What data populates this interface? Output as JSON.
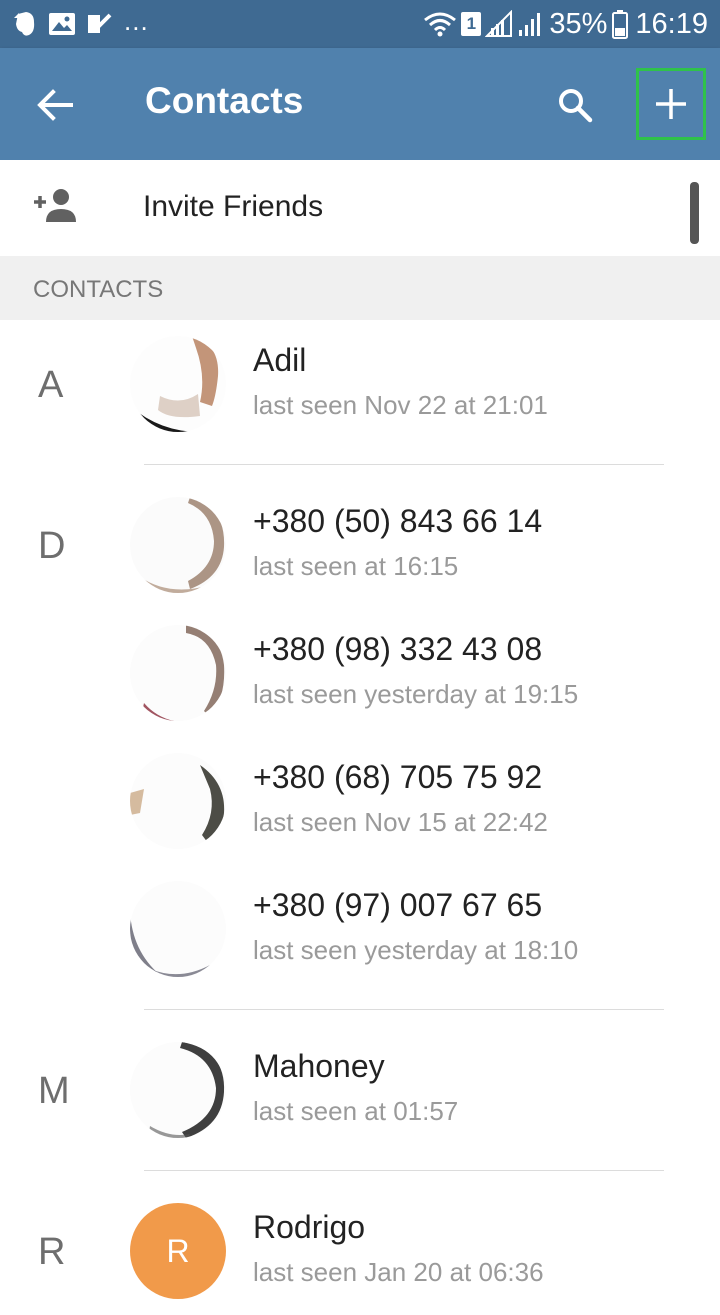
{
  "status_bar": {
    "more": "...",
    "sim_slot": "1",
    "battery": "35%",
    "time": "16:19"
  },
  "app_bar": {
    "title": "Contacts"
  },
  "invite": {
    "label": "Invite Friends"
  },
  "section": {
    "title": "CONTACTS"
  },
  "contacts": [
    {
      "letter": "A",
      "name": "Adil",
      "status": "last seen Nov 22 at 21:01"
    },
    {
      "letter": "D",
      "name": "+380 (50) 843 66 14",
      "status": "last seen at 16:15"
    },
    {
      "letter": "",
      "name": "+380 (98) 332 43 08",
      "status": "last seen yesterday at 19:15"
    },
    {
      "letter": "",
      "name": "+380 (68) 705 75 92",
      "status": "last seen Nov 15 at 22:42"
    },
    {
      "letter": "",
      "name": "+380 (97) 007 67 65",
      "status": "last seen yesterday at 18:10"
    },
    {
      "letter": "M",
      "name": "Mahoney",
      "status": "last seen at 01:57"
    },
    {
      "letter": "R",
      "name": "Rodrigo",
      "status": "last seen Jan 20 at 06:36",
      "initial": "R"
    }
  ],
  "colors": {
    "status_bar": "#3f6a92",
    "app_bar": "#5081ad",
    "highlight": "#2fc24a",
    "avatar_orange": "#f19a4a"
  }
}
